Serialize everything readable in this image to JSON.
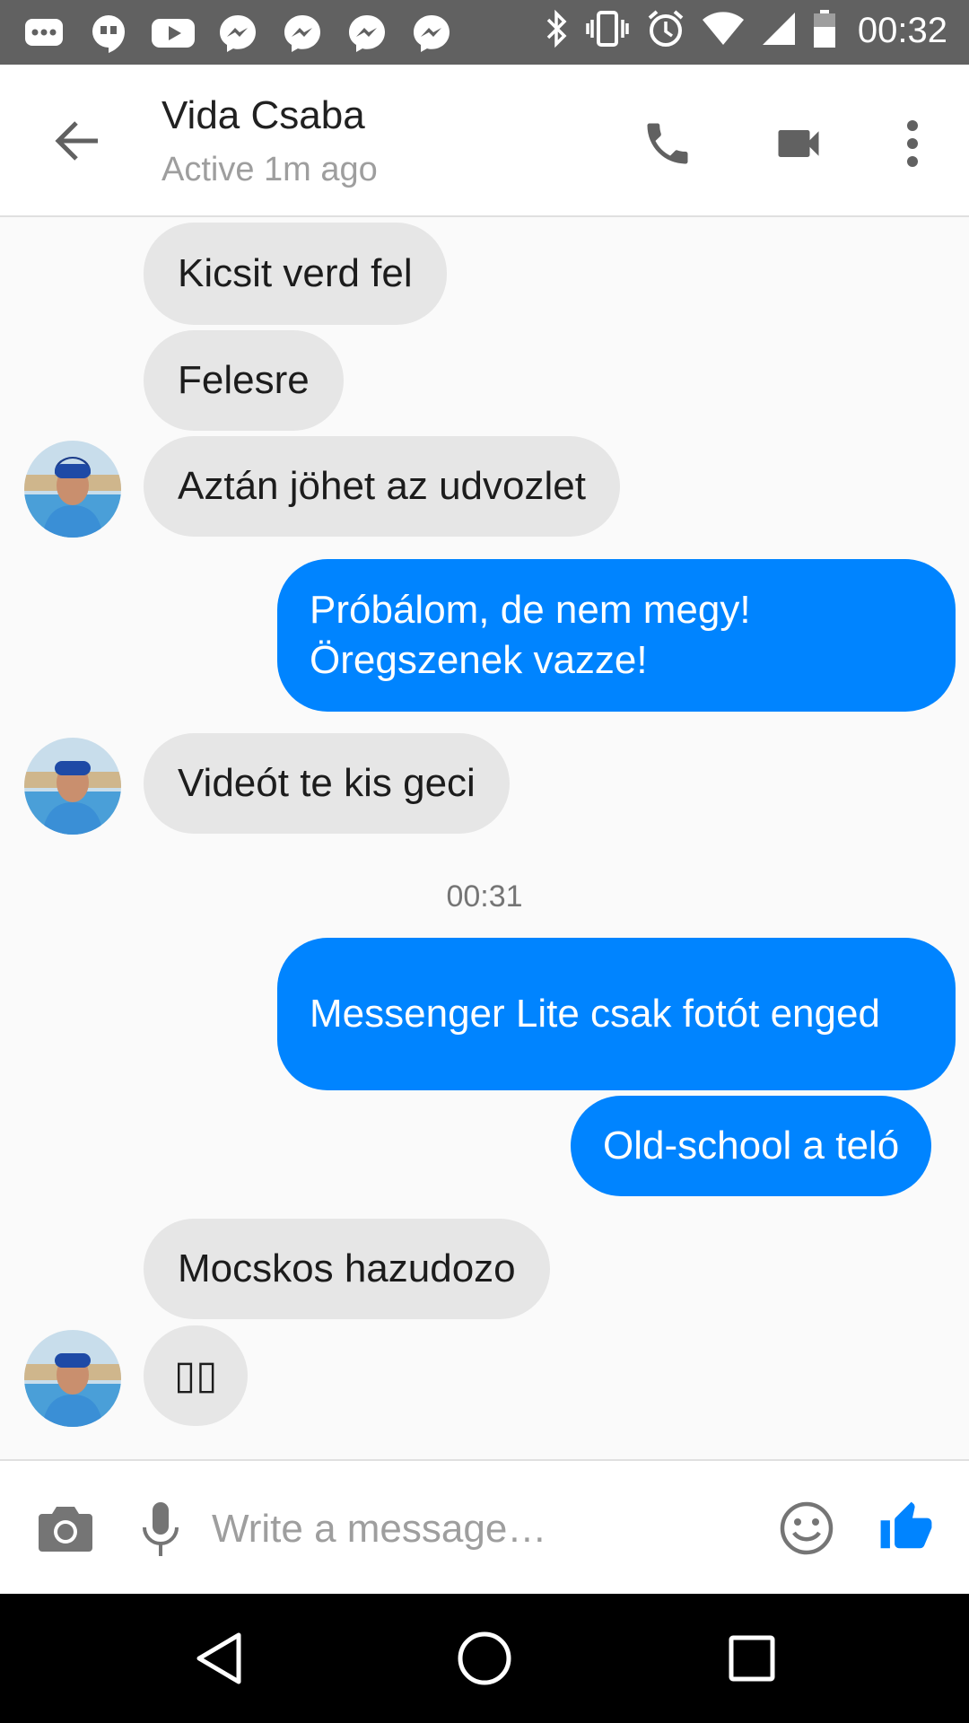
{
  "status_bar": {
    "time": "00:32",
    "left_icons": [
      "chat-bubble-icon",
      "hangouts-icon",
      "youtube-icon",
      "messenger-icon",
      "messenger-icon",
      "messenger-icon",
      "messenger-icon"
    ],
    "right_icons": [
      "bluetooth-icon",
      "vibrate-icon",
      "alarm-icon",
      "wifi-icon",
      "signal-icon",
      "battery-icon"
    ]
  },
  "header": {
    "contact_name": "Vida Csaba",
    "status": "Active 1m ago"
  },
  "colors": {
    "accent": "#0084ff",
    "incoming_bubble": "#e6e6e6",
    "background": "#fafafa",
    "status_bar": "#616161"
  },
  "messages": [
    {
      "side": "in",
      "text": "Kicsit verd fel"
    },
    {
      "side": "in",
      "text": "Felesre"
    },
    {
      "side": "in",
      "text": "Aztán jöhet az udvozlet"
    },
    {
      "side": "out",
      "text": "Próbálom, de nem megy! Öregszenek vazze!"
    },
    {
      "side": "in",
      "text": "Videót te kis geci"
    },
    {
      "side": "out",
      "text": "Messenger Lite csak fotót enged"
    },
    {
      "side": "out",
      "text": "Old-school a teló"
    },
    {
      "side": "in",
      "text": "Mocskos hazudozo"
    },
    {
      "side": "in",
      "text": "▯▯"
    }
  ],
  "timestamp": "00:31",
  "composer": {
    "placeholder": "Write a message…"
  }
}
